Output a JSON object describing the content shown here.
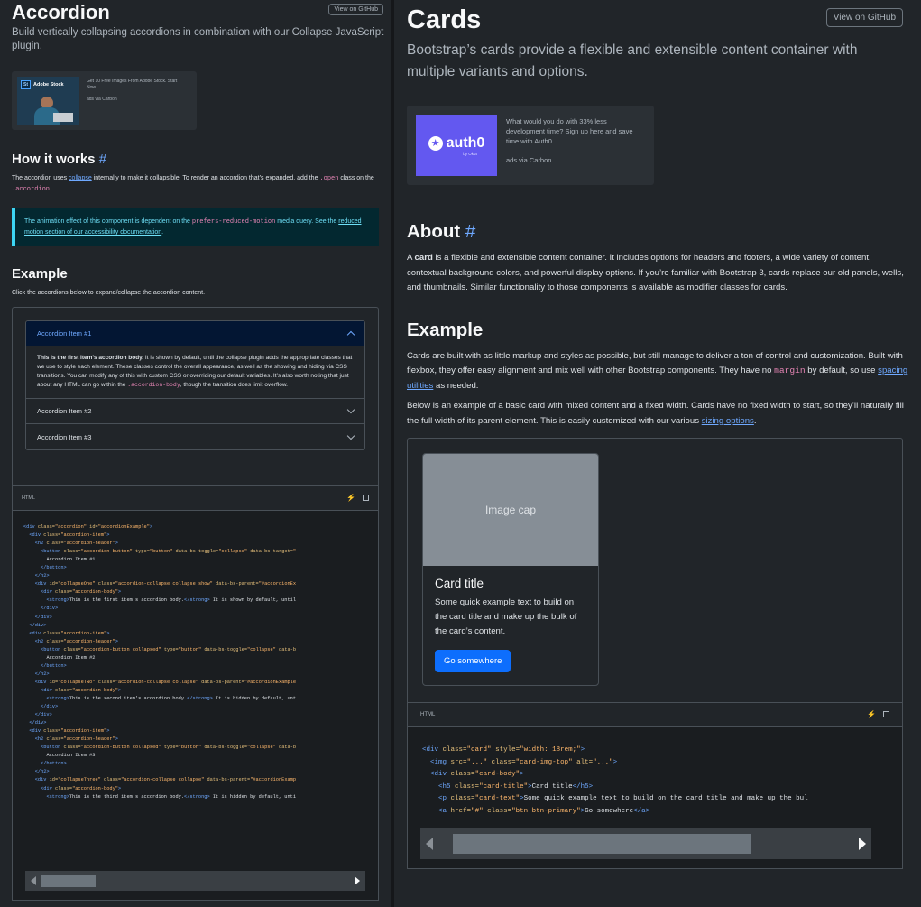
{
  "left": {
    "github_btn": "View on GitHub",
    "title": "Accordion",
    "lead": "Build vertically collapsing accordions in combination with our Collapse JavaScript plugin.",
    "ad": {
      "logo": "St",
      "brand": "Adobe Stock",
      "text": "Get 10 Free Images From Adobe Stock. Start Now.",
      "via": "ads via Carbon"
    },
    "how": {
      "title": "How it works",
      "hash": "#",
      "p1": "The accordion uses ",
      "collapse_link": "collapse",
      "p2": " internally to make it collapsible. To render an accordion that’s expanded, add the ",
      "open_code": ".open",
      "p3": " class on the ",
      "acc_code": ".accordion",
      "p4": "."
    },
    "callout": {
      "t1": "The animation effect of this component is dependent on the ",
      "code": "prefers-reduced-motion",
      "t2": " media query. See the ",
      "link": "reduced motion section of our accessibility documentation",
      "t3": "."
    },
    "example": {
      "title": "Example",
      "desc": "Click the accordions below to expand/collapse the accordion content."
    },
    "accordion": {
      "item1": "Accordion Item #1",
      "body_strong": "This is the first item’s accordion body.",
      "body_text": " It is shown by default, until the collapse plugin adds the appropriate classes that we use to style each element. These classes control the overall appearance, as well as the showing and hiding via CSS transitions. You can modify any of this with custom CSS or overriding our default variables. It’s also worth noting that just about any HTML can go within the ",
      "body_code": ".accordion-body",
      "body_end": ", though the transition does limit overflow.",
      "item2": "Accordion Item #2",
      "item3": "Accordion Item #3"
    },
    "code_label": "HTML"
  },
  "right": {
    "github_btn": "View on GitHub",
    "title": "Cards",
    "lead": "Bootstrap’s cards provide a flexible and extensible content container with multiple variants and options.",
    "ad": {
      "brand": "auth0",
      "sub": "by Okta",
      "text": "What would you do with 33% less development time? Sign up here and save time with Auth0.",
      "via": "ads via Carbon"
    },
    "about": {
      "title": "About",
      "hash": "#",
      "t1": "A ",
      "strong": "card",
      "t2": " is a flexible and extensible content container. It includes options for headers and footers, a wide variety of content, contextual background colors, and powerful display options. If you’re familiar with Bootstrap 3, cards replace our old panels, wells, and thumbnails. Similar functionality to those components is available as modifier classes for cards."
    },
    "example": {
      "title": "Example",
      "p1a": "Cards are built with as little markup and styles as possible, but still manage to deliver a ton of control and customization. Built with flexbox, they offer easy alignment and mix well with other Bootstrap components. They have no ",
      "p1code": "margin",
      "p1b": " by default, so use ",
      "p1link": "spacing utilities",
      "p1c": " as needed.",
      "p2a": "Below is an example of a basic card with mixed content and a fixed width. Cards have no fixed width to start, so they’ll naturally fill the full width of its parent element. This is easily customized with our various ",
      "p2link": "sizing options",
      "p2b": "."
    },
    "card": {
      "img": "Image cap",
      "title": "Card title",
      "text": "Some quick example text to build on the card title and make up the bulk of the card’s content.",
      "button": "Go somewhere"
    },
    "code_label": "HTML"
  }
}
